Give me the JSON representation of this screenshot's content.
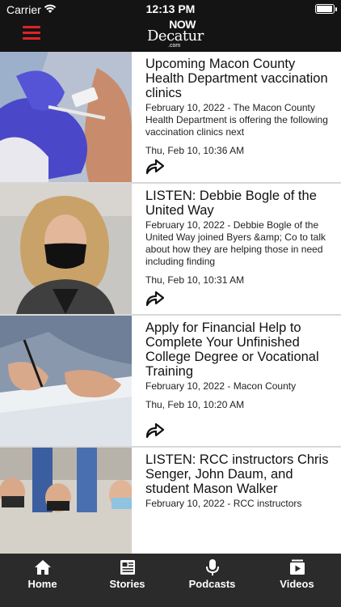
{
  "status": {
    "carrier": "Carrier",
    "time": "12:13 PM",
    "battery_level": 0.95
  },
  "header": {
    "logo_now": "NOW",
    "logo_name": "Decatur",
    "logo_suffix": ".com"
  },
  "articles": [
    {
      "title": "Upcoming Macon County Health Department vaccination clinics",
      "description": "February 10, 2022 - The Macon County Health Department is offering the following vaccination clinics next",
      "timestamp": "Thu, Feb 10, 10:36 AM"
    },
    {
      "title": "LISTEN: Debbie Bogle of the United Way",
      "description": "February 10, 2022 - Debbie Bogle of the United Way joined Byers &amp; Co to talk about how they are helping those in need including finding",
      "timestamp": "Thu, Feb 10, 10:31 AM"
    },
    {
      "title": "Apply for Financial Help to Complete Your Unfinished College Degree or Vocational Training",
      "description": "February 10, 2022 - Macon County",
      "timestamp": "Thu, Feb 10, 10:20 AM"
    },
    {
      "title": "LISTEN: RCC instructors Chris Senger, John Daum, and student Mason Walker",
      "description": "February 10, 2022 - RCC instructors",
      "timestamp": ""
    }
  ],
  "nav": {
    "home": "Home",
    "stories": "Stories",
    "podcasts": "Podcasts",
    "videos": "Videos"
  },
  "colors": {
    "header_bg": "#141414",
    "accent": "#e0232a",
    "nav_bg": "#2b2b2b"
  }
}
